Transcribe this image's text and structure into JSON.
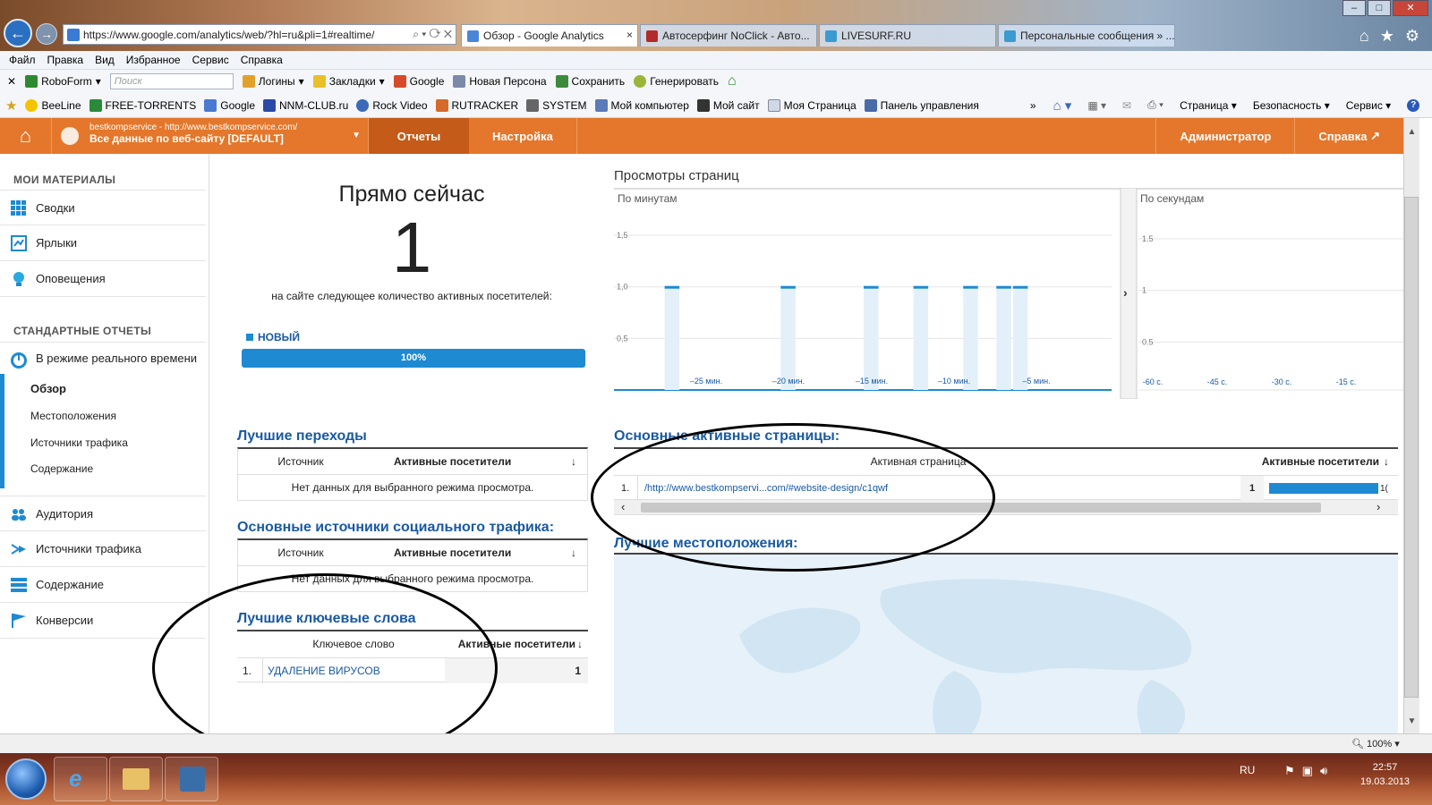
{
  "browser": {
    "url": "https://www.google.com/analytics/web/?hl=ru&pli=1#realtime/",
    "tabs": [
      {
        "title": "Обзор - Google Analytics",
        "close": "×"
      },
      {
        "title": "Автосерфинг NoClick - Авто..."
      },
      {
        "title": "LIVESURF.RU"
      },
      {
        "title": "Персональные сообщения » ..."
      }
    ],
    "menu": [
      "Файл",
      "Правка",
      "Вид",
      "Избранное",
      "Сервис",
      "Справка"
    ],
    "toolbar1": {
      "roboform": "RoboForm",
      "search_placeholder": "Поиск",
      "items": [
        "Логины",
        "Закладки",
        "Google",
        "Новая Персона",
        "Сохранить",
        "Генерировать"
      ]
    },
    "toolbar2": {
      "favorites": [
        "BeeLine",
        "FREE-TORRENTS",
        "Google",
        "NNM-CLUB.ru",
        "Rock Video",
        "RUTRACKER",
        "SYSTEM",
        "Мой компьютер",
        "Мой сайт",
        "Моя Страница",
        "Панель управления"
      ],
      "right": [
        "Страница",
        "Безопасность",
        "Сервис"
      ],
      "more": "»"
    }
  },
  "ga": {
    "account_url": "bestkompservice - http://www.bestkompservice.com/",
    "account_view": "Все данные по веб-сайту [DEFAULT]",
    "nav": {
      "reports": "Отчеты",
      "settings": "Настройка",
      "admin": "Администратор",
      "help": "Справка"
    },
    "sidebar": {
      "my_header": "МОИ МАТЕРИАЛЫ",
      "my_items": [
        "Сводки",
        "Ярлыки",
        "Оповещения"
      ],
      "std_header": "СТАНДАРТНЫЕ ОТЧЕТЫ",
      "realtime": "В режиме реального времени",
      "realtime_sub": [
        "Обзор",
        "Местоположения",
        "Источники трафика",
        "Содержание"
      ],
      "other": [
        "Аудитория",
        "Источники трафика",
        "Содержание",
        "Конверсии"
      ]
    },
    "rightnow": {
      "title": "Прямо сейчас",
      "count": "1",
      "caption": "на сайте следующее количество активных посетителей:",
      "legend": "НОВЫЙ",
      "bar_label": "100%",
      "bar_fraction": 1.0
    },
    "referrals": {
      "title": "Лучшие переходы",
      "col1": "Источник",
      "col2": "Активные посетители",
      "empty": "Нет данных для выбранного режима просмотра."
    },
    "social": {
      "title": "Основные источники социального трафика:",
      "col1": "Источник",
      "col2": "Активные посетители",
      "empty": "Нет данных для выбранного режима просмотра."
    },
    "keywords": {
      "title": "Лучшие ключевые слова",
      "col1": "Ключевое слово",
      "col2": "Активные посетители",
      "rows": [
        {
          "n": "1.",
          "keyword": "УДАЛЕНИЕ ВИРУСОВ",
          "value": "1"
        }
      ]
    },
    "pageviews": {
      "title": "Просмотры страниц",
      "per_minute": "По минутам",
      "per_second": "По секундам",
      "expand": "›"
    },
    "active_pages": {
      "title": "Основные активные страницы:",
      "col1": "Активная страница",
      "col2": "Активные посетители",
      "rows": [
        {
          "n": "1.",
          "page": "/http://www.bestkompservi...com/#website-design/c1qwf",
          "value": "1",
          "cut": "1("
        }
      ]
    },
    "locations": {
      "title": "Лучшие местоположения:"
    }
  },
  "chart_data": [
    {
      "type": "bar",
      "title": "По минутам",
      "x_tick_labels": [
        "–25 мин.",
        "–20 мин.",
        "–15 мин.",
        "–10 мин.",
        "–5 мин."
      ],
      "y_tick_labels": [
        "0,5",
        "1,0",
        "1,5"
      ],
      "ylim": [
        0,
        1.7
      ],
      "bar_slots": 30,
      "values": [
        0,
        0,
        0,
        1,
        0,
        0,
        0,
        0,
        0,
        0,
        1,
        0,
        0,
        0,
        0,
        1,
        0,
        0,
        1,
        0,
        0,
        1,
        0,
        1,
        1,
        0,
        0,
        0,
        0,
        0
      ],
      "grid": true
    },
    {
      "type": "bar",
      "title": "По секундам",
      "x_tick_labels": [
        "-60 с.",
        "-45 с.",
        "-30 с.",
        "-15 с."
      ],
      "y_tick_labels": [
        "0.5",
        "1",
        "1.5"
      ],
      "ylim": [
        0,
        1.7
      ],
      "values": [],
      "grid": true
    }
  ],
  "status": {
    "zoom": "100%"
  },
  "taskbar": {
    "lang": "RU",
    "time": "22:57",
    "date": "19.03.2013"
  },
  "colors": {
    "ga_orange": "#e4772b",
    "ga_orange_dark": "#c45b18",
    "link_blue": "#1a5aa3",
    "bar_blue": "#1d8ad2"
  }
}
